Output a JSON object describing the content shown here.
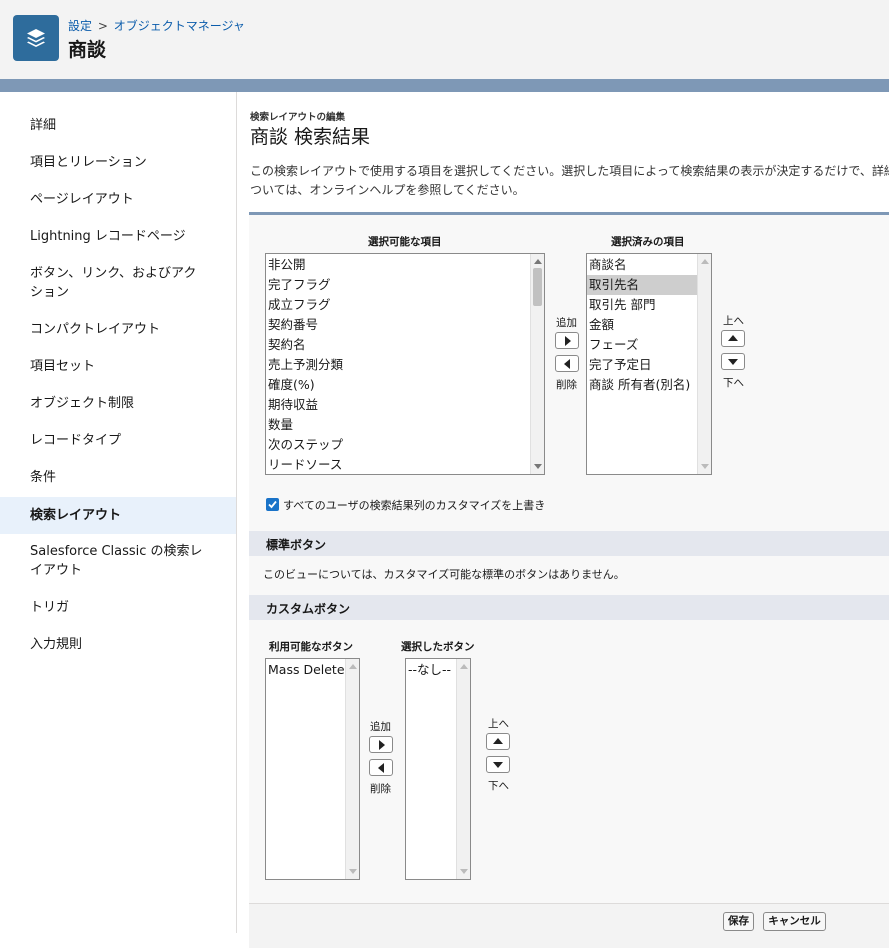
{
  "header": {
    "breadcrumb": [
      "設定",
      "オブジェクトマネージャ"
    ],
    "breadcrumb_separator": ">",
    "title": "商談",
    "icon": "layers-icon",
    "colors": {
      "icon_bg": "#2e6c9c",
      "band": "#7e98b6",
      "link": "#0b5cab"
    }
  },
  "sidebar": {
    "items": [
      {
        "label": "詳細"
      },
      {
        "label": "項目とリレーション"
      },
      {
        "label": "ページレイアウト"
      },
      {
        "label": "Lightning レコードページ"
      },
      {
        "label": "ボタン、リンク、およびアクション"
      },
      {
        "label": "コンパクトレイアウト"
      },
      {
        "label": "項目セット"
      },
      {
        "label": "オブジェクト制限"
      },
      {
        "label": "レコードタイプ"
      },
      {
        "label": "条件"
      },
      {
        "label": "検索レイアウト",
        "active": true
      },
      {
        "label": "Salesforce Classic の検索レイアウト"
      },
      {
        "label": "トリガ"
      },
      {
        "label": "入力規則"
      }
    ]
  },
  "page": {
    "subtitle": "検索レイアウトの編集",
    "title": "商談 検索結果",
    "description": "この検索レイアウトで使用する項目を選択してください。選択した項目によって検索結果の表示が決定するだけで、詳細については、オンラインヘルプを参照してください。"
  },
  "fields": {
    "available_label": "選択可能な項目",
    "available": [
      "非公開",
      "完了フラグ",
      "成立フラグ",
      "契約番号",
      "契約名",
      "売上予測分類",
      "確度(%)",
      "期待収益",
      "数量",
      "次のステップ",
      "リードソース"
    ],
    "selected_label": "選択済みの項目",
    "selected": [
      "商談名",
      "取引先名",
      "取引先 部門",
      "金額",
      "フェーズ",
      "完了予定日",
      "商談 所有者(別名)"
    ],
    "selected_highlight": "取引先名",
    "add_label": "追加",
    "remove_label": "削除",
    "up_label": "上へ",
    "down_label": "下へ"
  },
  "override_checkbox": {
    "label": "すべてのユーザの検索結果列のカスタマイズを上書き",
    "checked": true
  },
  "standard_buttons": {
    "title": "標準ボタン",
    "message": "このビューについては、カスタマイズ可能な標準のボタンはありません。"
  },
  "custom_buttons": {
    "title": "カスタムボタン",
    "available_label": "利用可能なボタン",
    "available": [
      "Mass Delete"
    ],
    "selected_label": "選択したボタン",
    "selected": [
      "--なし--"
    ],
    "add_label": "追加",
    "remove_label": "削除",
    "up_label": "上へ",
    "down_label": "下へ"
  },
  "footer": {
    "save_label": "保存",
    "cancel_label": "キャンセル"
  }
}
